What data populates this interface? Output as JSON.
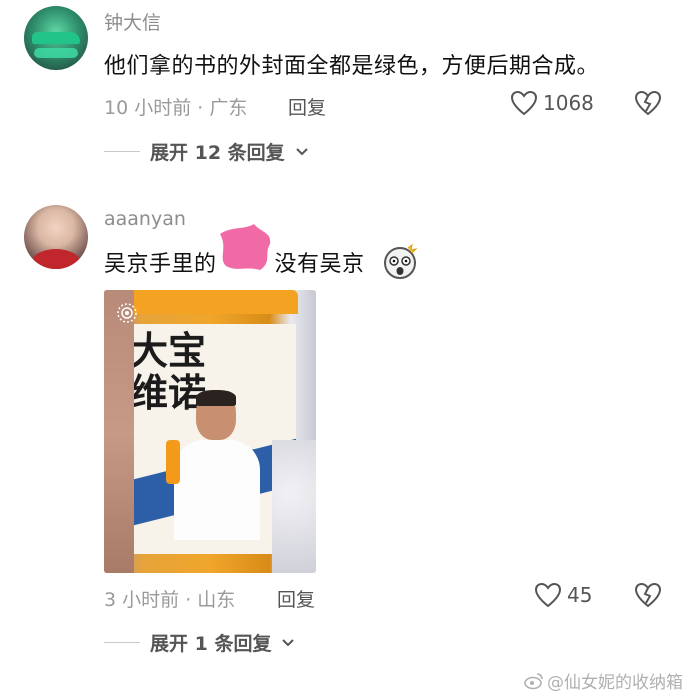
{
  "comments": [
    {
      "username": "钟大信",
      "text": "他们拿的书的外封面全都是绿色，方便后期合成。",
      "time": "10 小时前",
      "separator": "·",
      "location": "广东",
      "reply_label": "回复",
      "likes": "1068",
      "expand_label": "展开 12 条回复",
      "avatar_icon": "avatar-green-car"
    },
    {
      "username": "aaanyan",
      "text_before": "吴京手里的",
      "text_after": "没有吴京",
      "emoji_icon": "shocked-face-emoji",
      "time": "3 小时前",
      "separator": "·",
      "location": "山东",
      "reply_label": "回复",
      "likes": "45",
      "expand_label": "展开 1 条回复",
      "avatar_icon": "avatar-woman-red"
    }
  ],
  "photo": {
    "brand_text": "大宝\n维诺",
    "label_name": "吴京"
  },
  "watermark": "@仙女妮的收纳箱",
  "colors": {
    "text_primary": "#111111",
    "text_meta": "#9a9a9a",
    "icon": "#555555",
    "redaction": "#f06aa6",
    "bottle_orange": "#f0a62a"
  }
}
